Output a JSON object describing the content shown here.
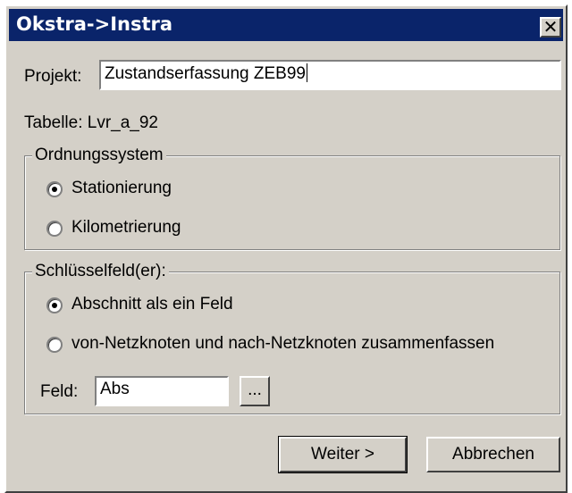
{
  "window": {
    "title": "Okstra->Instra",
    "close_glyph": "✕"
  },
  "project": {
    "label": "Projekt:",
    "value": "Zustandserfassung ZEB99"
  },
  "table_info": "Tabelle: Lvr_a_92",
  "ordnungssystem": {
    "legend": "Ordnungssystem",
    "options": [
      {
        "label": "Stationierung",
        "selected": true
      },
      {
        "label": "Kilometrierung",
        "selected": false
      }
    ]
  },
  "schluesselfeld": {
    "legend": "Schlüsselfeld(er):",
    "options": [
      {
        "label": "Abschnitt als ein Feld",
        "selected": true
      },
      {
        "label": "von-Netzknoten und nach-Netzknoten zusammenfassen",
        "selected": false
      }
    ],
    "field_label": "Feld:",
    "field_value": "Abs",
    "browse_label": "..."
  },
  "buttons": {
    "next": "Weiter >",
    "cancel": "Abbrechen"
  }
}
